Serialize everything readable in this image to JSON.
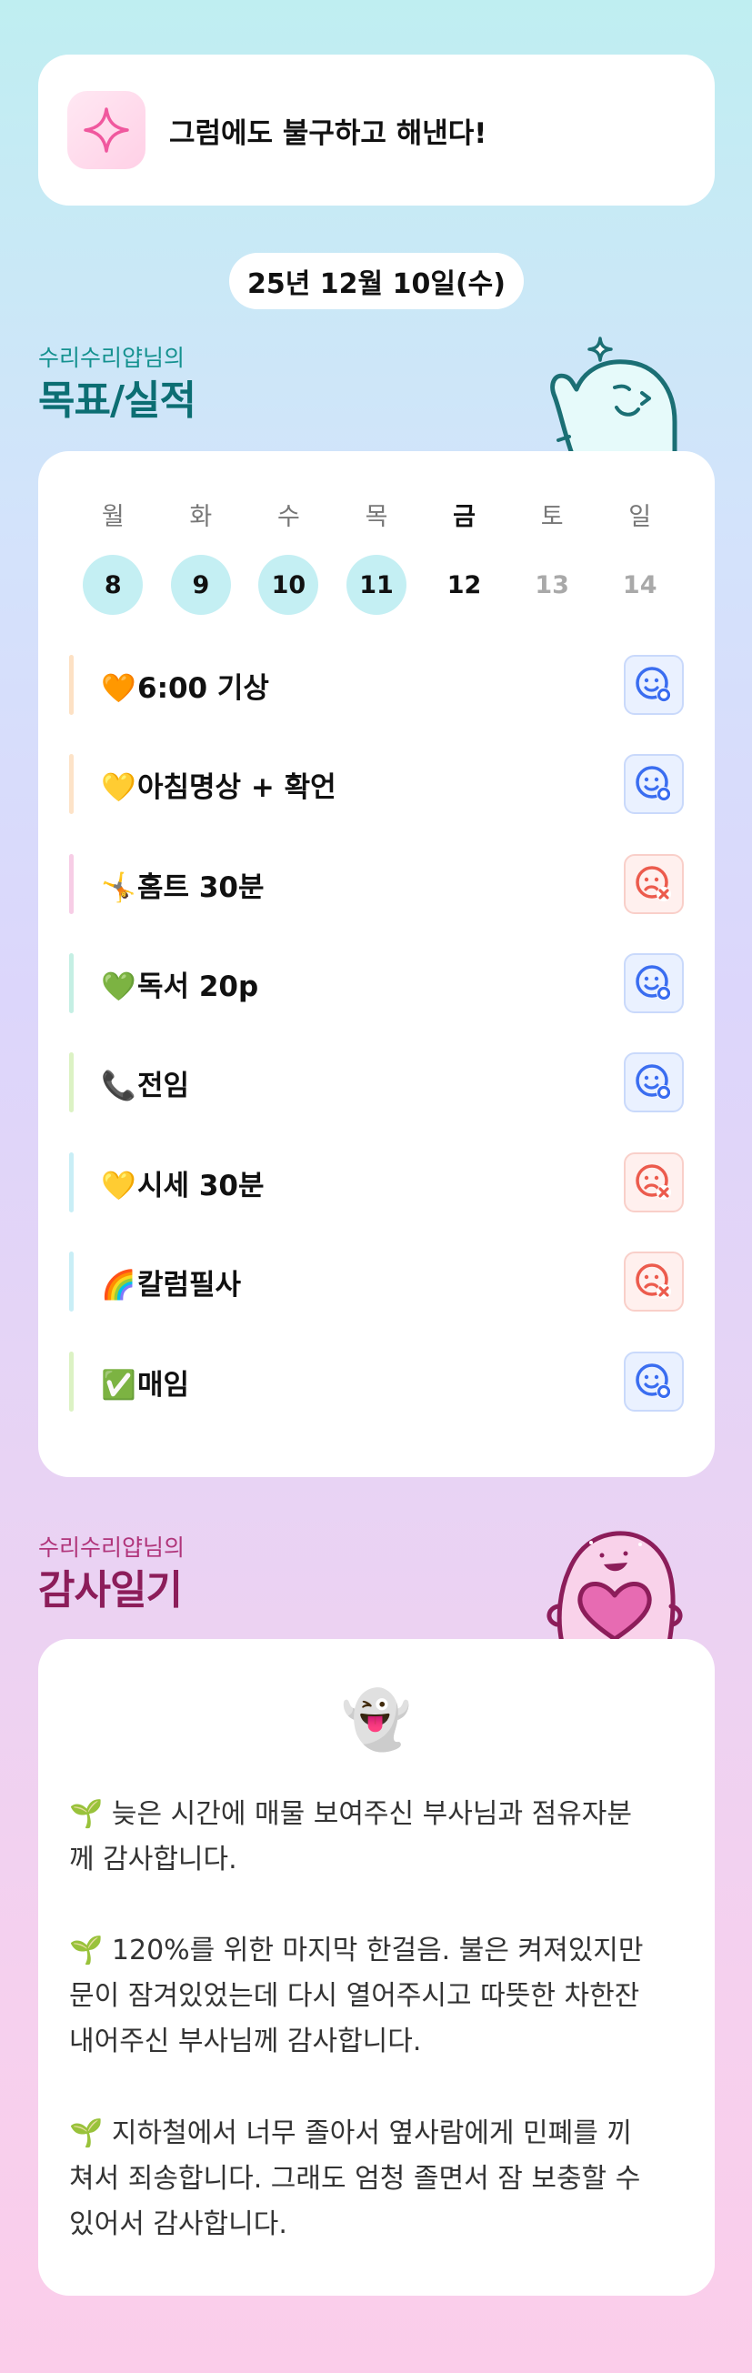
{
  "motto": {
    "icon": "sparkle-icon",
    "text": "그럼에도 불구하고 해낸다!"
  },
  "date": "25년 12월 10일(수)",
  "goals_section": {
    "owner": "수리수리얍님의",
    "title": "목표/실적"
  },
  "week": {
    "days": [
      {
        "name": "월",
        "num": "8",
        "state": "done"
      },
      {
        "name": "화",
        "num": "9",
        "state": "done"
      },
      {
        "name": "수",
        "num": "10",
        "state": "done"
      },
      {
        "name": "목",
        "num": "11",
        "state": "done"
      },
      {
        "name": "금",
        "num": "12",
        "state": "today"
      },
      {
        "name": "토",
        "num": "13",
        "state": "future"
      },
      {
        "name": "일",
        "num": "14",
        "state": "future"
      }
    ]
  },
  "goals": [
    {
      "emoji": "🧡",
      "label": "6:00 기상",
      "status": "success",
      "color": "#fde1c4"
    },
    {
      "emoji": "💛",
      "label": "아침명상 + 확언",
      "status": "success",
      "color": "#fde3c8"
    },
    {
      "emoji": "🤸",
      "label": "홈트 30분",
      "status": "fail",
      "color": "#f7cde6"
    },
    {
      "emoji": "💚",
      "label": "독서 20p",
      "status": "success",
      "color": "#c5efe4"
    },
    {
      "emoji": "📞",
      "label": "전임",
      "status": "success",
      "color": "#dcf2c4"
    },
    {
      "emoji": "💛",
      "label": "시세 30분",
      "status": "fail",
      "color": "#c9eef6"
    },
    {
      "emoji": "🌈",
      "label": "칼럼필사",
      "status": "fail",
      "color": "#c9eef6"
    },
    {
      "emoji": "✅",
      "label": "매임",
      "status": "success",
      "color": "#dcf2c4"
    }
  ],
  "status_icons": {
    "success": "smile-check-icon",
    "fail": "frown-x-icon"
  },
  "colors": {
    "success": "#3a6df0",
    "fail": "#ec5b4d",
    "goal_title": "#0c6e73",
    "thanks_title": "#8c1d5a"
  },
  "thanks_section": {
    "owner": "수리수리얍님의",
    "title": "감사일기"
  },
  "thanks": {
    "emoji": "👻",
    "entries": [
      {
        "bullet": "🌱",
        "lines": [
          "늦은 시간에 매물 보여주신 부사님과 점유자분",
          "께 감사합니다."
        ]
      },
      {
        "bullet": "🌱",
        "lines": [
          "120%를 위한 마지막 한걸음. 불은 켜져있지만",
          "문이 잠겨있었는데 다시 열어주시고 따뜻한 차한잔",
          "내어주신 부사님께 감사합니다."
        ]
      },
      {
        "bullet": "🌱",
        "lines": [
          "지하철에서 너무 졸아서 옆사람에게 민폐를 끼",
          "쳐서 죄송합니다. 그래도 엄청 졸면서 잠 보충할 수",
          "있어서 감사합니다."
        ]
      }
    ]
  }
}
